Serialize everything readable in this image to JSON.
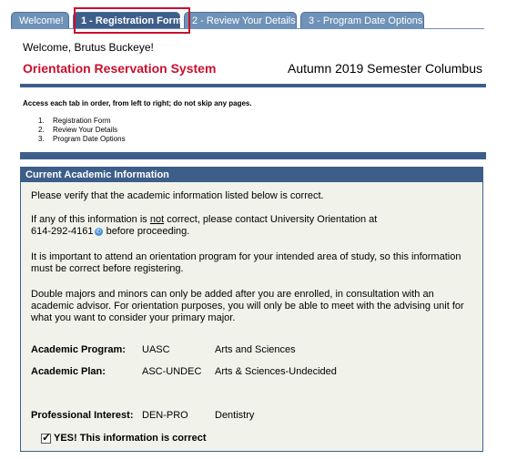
{
  "tabs": [
    {
      "label": "Welcome!"
    },
    {
      "label": "1 - Registration Form",
      "active": true
    },
    {
      "label": "2 - Review Your Details"
    },
    {
      "label": "3 - Program Date Options"
    }
  ],
  "header": {
    "welcome_prefix": "Welcome,",
    "user_name": "Brutus Buckeye!",
    "title": "Orientation Reservation System",
    "semester": "Autumn 2019 Semester Columbus"
  },
  "instructions": {
    "text": "Access each tab in order, from left to right; do not skip any pages.",
    "steps": [
      {
        "num": "1.",
        "label": "Registration Form"
      },
      {
        "num": "2.",
        "label": "Review Your Details"
      },
      {
        "num": "3.",
        "label": "Program Date Options"
      }
    ]
  },
  "panel": {
    "header": "Current Academic Information",
    "p1": "Please verify that the academic information listed below is correct.",
    "p2_a": "If any of this information is ",
    "p2_not": "not",
    "p2_b": " correct, please contact University Orientation at",
    "phone": "614-292-4161",
    "p2_c": " before proceeding.",
    "p3": "It is important to attend an orientation program for your intended area of study, so this information must be correct before registering.",
    "p4": "Double majors and minors can only be added after you are enrolled, in consultation with an academic advisor. For orientation purposes, you will only be able to meet with the advising unit for what you want to consider your primary major.",
    "rows": [
      {
        "label": "Academic Program:",
        "code": "UASC",
        "desc": "Arts and Sciences"
      },
      {
        "label": "Academic Plan:",
        "code": "ASC-UNDEC",
        "desc": "Arts & Sciences-Undecided"
      },
      {
        "label": "Professional Interest:",
        "code": "DEN-PRO",
        "desc": "Dentistry"
      }
    ],
    "confirm_label": "YES! This information is correct",
    "confirm_checked": true
  },
  "colors": {
    "brand_red": "#c8102e",
    "navy": "#3e5e8a",
    "tab_blue": "#6f92b8",
    "panel_bg": "#f1f3ea"
  }
}
